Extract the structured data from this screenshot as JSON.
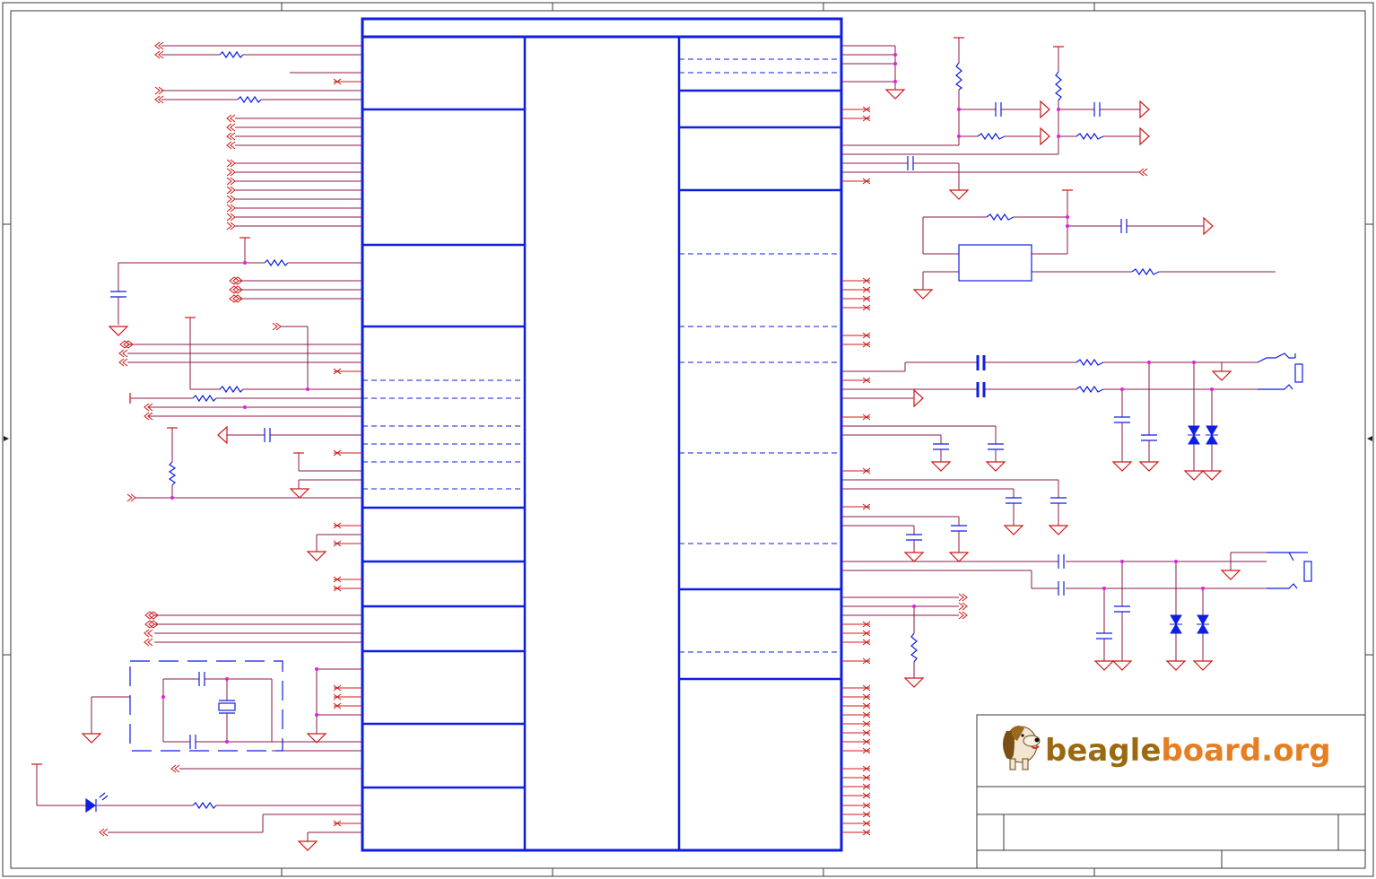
{
  "logo": {
    "word_a": "beagle",
    "word_b": "board",
    "word_c": ".org"
  },
  "colors": {
    "frame": "#3a3a3a",
    "wire": "#8b1a4a",
    "net": "#d01818",
    "ic": "#0f1ee0",
    "junction": "#e020e0",
    "logo_dark": "#9a6a10",
    "logo_light": "#e67e22"
  },
  "icons": [
    "hound-icon",
    "led-icon",
    "crystal-icon",
    "tvs-diode-icon",
    "audio-jack-icon"
  ]
}
